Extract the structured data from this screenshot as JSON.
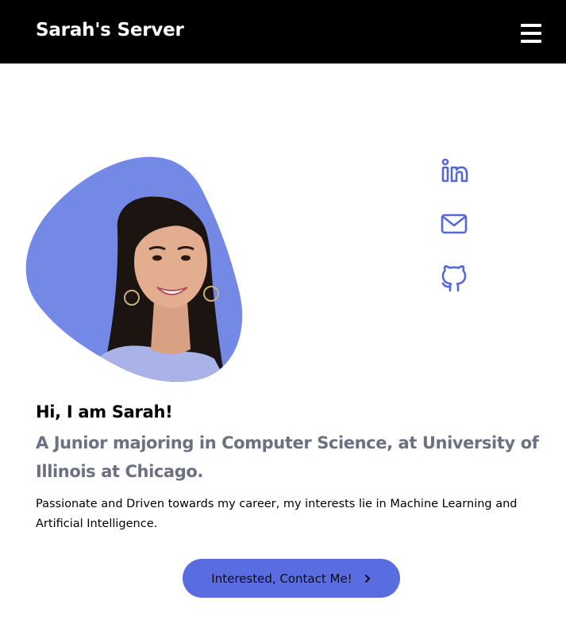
{
  "navbar": {
    "brand": "Sarah's Server",
    "menu_icon": "hamburger-menu-icon"
  },
  "hero": {
    "photo_alt": "Portrait of Sarah",
    "blob_color": "#7488e6"
  },
  "social": [
    {
      "name": "linkedin",
      "icon": "linkedin-icon"
    },
    {
      "name": "email",
      "icon": "mail-icon"
    },
    {
      "name": "github",
      "icon": "github-icon"
    }
  ],
  "about": {
    "greeting": "Hi, I am Sarah!",
    "subtitle": "A Junior majoring in Computer Science, at University of Illinois at Chicago.",
    "description": "Passionate and Driven towards my career, my interests lie in Machine Learning and Artificial Intelligence."
  },
  "cta": {
    "label": "Interested, Contact Me!",
    "icon": "chevron-right-icon"
  },
  "colors": {
    "navbar_bg": "#000000",
    "accent": "#5a6de0",
    "icon_color": "#5468d6",
    "subtitle_color": "#6b7083"
  }
}
